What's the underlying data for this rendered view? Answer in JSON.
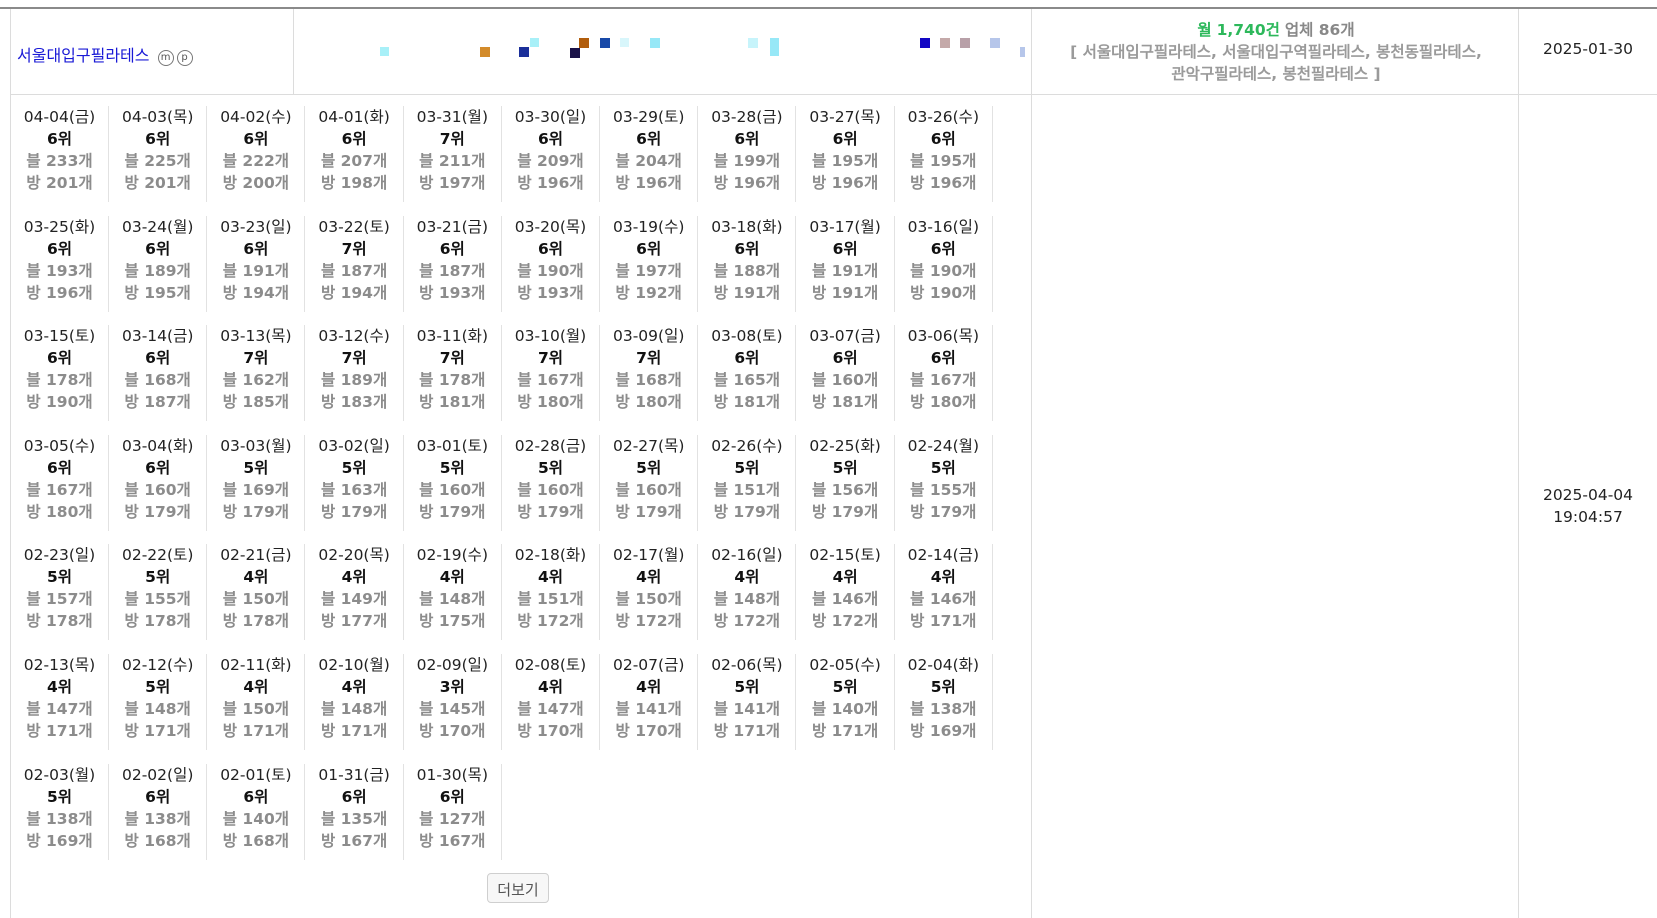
{
  "keyword": {
    "name": "서울대입구필라테스",
    "marks": [
      "m",
      "p"
    ]
  },
  "monthly": {
    "prefix": "월",
    "count": "1,740건",
    "suffix": "업체 86개",
    "related": "[ 서울대입구필라테스, 서울대입구역필라테스, 봉천동필라테스,",
    "related2": "관악구필라테스, 봉천필라테스 ]"
  },
  "registered_date": "2025-01-30",
  "updated_date": "2025-04-04",
  "updated_time": "19:04:57",
  "trend_colors": [
    "#a8f0f8",
    "#d38b2a",
    "#1b2f9a",
    "#a8f0f8",
    "#1a1248",
    "#b15d0c",
    "#1849a8",
    "#d8f6fb",
    "#97e8f7",
    "#c7f4fb",
    "#1207c4",
    "#c4a9a9",
    "#b8a0a8",
    "#b6c6ea"
  ],
  "more_label": "더보기",
  "days": [
    {
      "date": "04-04(금)",
      "rank": "6위",
      "blog": "블 233개",
      "place": "방 201개"
    },
    {
      "date": "04-03(목)",
      "rank": "6위",
      "blog": "블 225개",
      "place": "방 201개"
    },
    {
      "date": "04-02(수)",
      "rank": "6위",
      "blog": "블 222개",
      "place": "방 200개"
    },
    {
      "date": "04-01(화)",
      "rank": "6위",
      "blog": "블 207개",
      "place": "방 198개"
    },
    {
      "date": "03-31(월)",
      "rank": "7위",
      "blog": "블 211개",
      "place": "방 197개"
    },
    {
      "date": "03-30(일)",
      "rank": "6위",
      "blog": "블 209개",
      "place": "방 196개"
    },
    {
      "date": "03-29(토)",
      "rank": "6위",
      "blog": "블 204개",
      "place": "방 196개"
    },
    {
      "date": "03-28(금)",
      "rank": "6위",
      "blog": "블 199개",
      "place": "방 196개"
    },
    {
      "date": "03-27(목)",
      "rank": "6위",
      "blog": "블 195개",
      "place": "방 196개"
    },
    {
      "date": "03-26(수)",
      "rank": "6위",
      "blog": "블 195개",
      "place": "방 196개"
    },
    {
      "date": "03-25(화)",
      "rank": "6위",
      "blog": "블 193개",
      "place": "방 196개"
    },
    {
      "date": "03-24(월)",
      "rank": "6위",
      "blog": "블 189개",
      "place": "방 195개"
    },
    {
      "date": "03-23(일)",
      "rank": "6위",
      "blog": "블 191개",
      "place": "방 194개"
    },
    {
      "date": "03-22(토)",
      "rank": "7위",
      "blog": "블 187개",
      "place": "방 194개"
    },
    {
      "date": "03-21(금)",
      "rank": "6위",
      "blog": "블 187개",
      "place": "방 193개"
    },
    {
      "date": "03-20(목)",
      "rank": "6위",
      "blog": "블 190개",
      "place": "방 193개"
    },
    {
      "date": "03-19(수)",
      "rank": "6위",
      "blog": "블 197개",
      "place": "방 192개"
    },
    {
      "date": "03-18(화)",
      "rank": "6위",
      "blog": "블 188개",
      "place": "방 191개"
    },
    {
      "date": "03-17(월)",
      "rank": "6위",
      "blog": "블 191개",
      "place": "방 191개"
    },
    {
      "date": "03-16(일)",
      "rank": "6위",
      "blog": "블 190개",
      "place": "방 190개"
    },
    {
      "date": "03-15(토)",
      "rank": "6위",
      "blog": "블 178개",
      "place": "방 190개"
    },
    {
      "date": "03-14(금)",
      "rank": "6위",
      "blog": "블 168개",
      "place": "방 187개"
    },
    {
      "date": "03-13(목)",
      "rank": "7위",
      "blog": "블 162개",
      "place": "방 185개"
    },
    {
      "date": "03-12(수)",
      "rank": "7위",
      "blog": "블 189개",
      "place": "방 183개"
    },
    {
      "date": "03-11(화)",
      "rank": "7위",
      "blog": "블 178개",
      "place": "방 181개"
    },
    {
      "date": "03-10(월)",
      "rank": "7위",
      "blog": "블 167개",
      "place": "방 180개"
    },
    {
      "date": "03-09(일)",
      "rank": "7위",
      "blog": "블 168개",
      "place": "방 180개"
    },
    {
      "date": "03-08(토)",
      "rank": "6위",
      "blog": "블 165개",
      "place": "방 181개"
    },
    {
      "date": "03-07(금)",
      "rank": "6위",
      "blog": "블 160개",
      "place": "방 181개"
    },
    {
      "date": "03-06(목)",
      "rank": "6위",
      "blog": "블 167개",
      "place": "방 180개"
    },
    {
      "date": "03-05(수)",
      "rank": "6위",
      "blog": "블 167개",
      "place": "방 180개"
    },
    {
      "date": "03-04(화)",
      "rank": "6위",
      "blog": "블 160개",
      "place": "방 179개"
    },
    {
      "date": "03-03(월)",
      "rank": "5위",
      "blog": "블 169개",
      "place": "방 179개"
    },
    {
      "date": "03-02(일)",
      "rank": "5위",
      "blog": "블 163개",
      "place": "방 179개"
    },
    {
      "date": "03-01(토)",
      "rank": "5위",
      "blog": "블 160개",
      "place": "방 179개"
    },
    {
      "date": "02-28(금)",
      "rank": "5위",
      "blog": "블 160개",
      "place": "방 179개"
    },
    {
      "date": "02-27(목)",
      "rank": "5위",
      "blog": "블 160개",
      "place": "방 179개"
    },
    {
      "date": "02-26(수)",
      "rank": "5위",
      "blog": "블 151개",
      "place": "방 179개"
    },
    {
      "date": "02-25(화)",
      "rank": "5위",
      "blog": "블 156개",
      "place": "방 179개"
    },
    {
      "date": "02-24(월)",
      "rank": "5위",
      "blog": "블 155개",
      "place": "방 179개"
    },
    {
      "date": "02-23(일)",
      "rank": "5위",
      "blog": "블 157개",
      "place": "방 178개"
    },
    {
      "date": "02-22(토)",
      "rank": "5위",
      "blog": "블 155개",
      "place": "방 178개"
    },
    {
      "date": "02-21(금)",
      "rank": "4위",
      "blog": "블 150개",
      "place": "방 178개"
    },
    {
      "date": "02-20(목)",
      "rank": "4위",
      "blog": "블 149개",
      "place": "방 177개"
    },
    {
      "date": "02-19(수)",
      "rank": "4위",
      "blog": "블 148개",
      "place": "방 175개"
    },
    {
      "date": "02-18(화)",
      "rank": "4위",
      "blog": "블 151개",
      "place": "방 172개"
    },
    {
      "date": "02-17(월)",
      "rank": "4위",
      "blog": "블 150개",
      "place": "방 172개"
    },
    {
      "date": "02-16(일)",
      "rank": "4위",
      "blog": "블 148개",
      "place": "방 172개"
    },
    {
      "date": "02-15(토)",
      "rank": "4위",
      "blog": "블 146개",
      "place": "방 172개"
    },
    {
      "date": "02-14(금)",
      "rank": "4위",
      "blog": "블 146개",
      "place": "방 171개"
    },
    {
      "date": "02-13(목)",
      "rank": "4위",
      "blog": "블 147개",
      "place": "방 171개"
    },
    {
      "date": "02-12(수)",
      "rank": "5위",
      "blog": "블 148개",
      "place": "방 171개"
    },
    {
      "date": "02-11(화)",
      "rank": "4위",
      "blog": "블 150개",
      "place": "방 171개"
    },
    {
      "date": "02-10(월)",
      "rank": "4위",
      "blog": "블 148개",
      "place": "방 171개"
    },
    {
      "date": "02-09(일)",
      "rank": "3위",
      "blog": "블 145개",
      "place": "방 170개"
    },
    {
      "date": "02-08(토)",
      "rank": "4위",
      "blog": "블 147개",
      "place": "방 170개"
    },
    {
      "date": "02-07(금)",
      "rank": "4위",
      "blog": "블 141개",
      "place": "방 170개"
    },
    {
      "date": "02-06(목)",
      "rank": "5위",
      "blog": "블 141개",
      "place": "방 171개"
    },
    {
      "date": "02-05(수)",
      "rank": "5위",
      "blog": "블 140개",
      "place": "방 171개"
    },
    {
      "date": "02-04(화)",
      "rank": "5위",
      "blog": "블 138개",
      "place": "방 169개"
    },
    {
      "date": "02-03(월)",
      "rank": "5위",
      "blog": "블 138개",
      "place": "방 169개"
    },
    {
      "date": "02-02(일)",
      "rank": "6위",
      "blog": "블 138개",
      "place": "방 168개"
    },
    {
      "date": "02-01(토)",
      "rank": "6위",
      "blog": "블 140개",
      "place": "방 168개"
    },
    {
      "date": "01-31(금)",
      "rank": "6위",
      "blog": "블 135개",
      "place": "방 167개"
    },
    {
      "date": "01-30(목)",
      "rank": "6위",
      "blog": "블 127개",
      "place": "방 167개"
    }
  ]
}
